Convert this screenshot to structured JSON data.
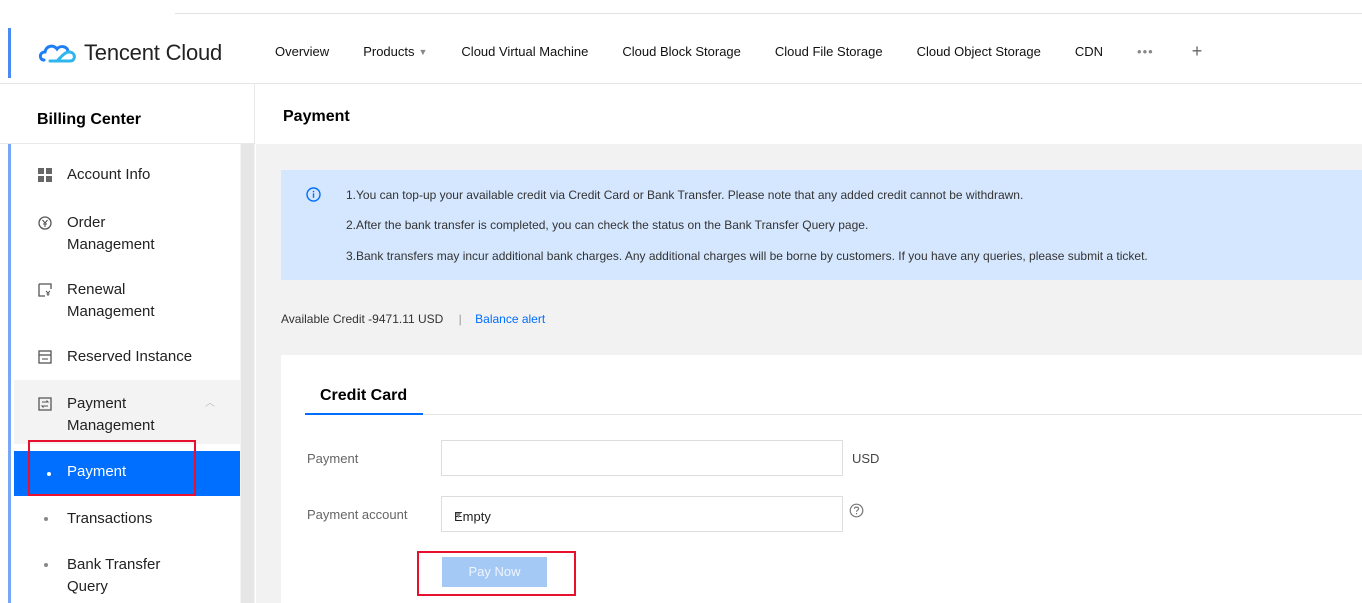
{
  "header": {
    "logo_text": "Tencent Cloud",
    "nav": [
      {
        "label": "Overview"
      },
      {
        "label": "Products"
      },
      {
        "label": "Cloud Virtual Machine"
      },
      {
        "label": "Cloud Block Storage"
      },
      {
        "label": "Cloud File Storage"
      },
      {
        "label": "Cloud Object Storage"
      },
      {
        "label": "CDN"
      }
    ],
    "more": "•••",
    "plus": "+"
  },
  "sidebar": {
    "title": "Billing Center",
    "items": [
      {
        "line1": "Account Info",
        "line2": ""
      },
      {
        "line1": "Order",
        "line2": "Management"
      },
      {
        "line1": "Renewal",
        "line2": "Management"
      },
      {
        "line1": "Reserved Instance",
        "line2": ""
      },
      {
        "line1": "Payment",
        "line2": "Management"
      }
    ],
    "subitems": {
      "payment": "Payment",
      "transactions": "Transactions",
      "bank_line1": "Bank Transfer",
      "bank_line2": "Query"
    }
  },
  "main": {
    "title": "Payment",
    "notice": [
      "1.You can top-up your available credit via Credit Card or Bank Transfer. Please note that any added credit cannot be withdrawn.",
      "2.After the bank transfer is completed, you can check the status on the Bank Transfer Query page.",
      "3.Bank transfers may incur additional bank charges. Any additional charges will be borne by customers. If you have any queries, please submit a ticket."
    ],
    "credit": {
      "label": "Available Credit",
      "value": "-9471.11 USD",
      "separator": "|",
      "link": "Balance alert"
    },
    "tab": "Credit Card",
    "form": {
      "payment_label": "Payment",
      "payment_value": "",
      "unit": "USD",
      "account_label": "Payment account",
      "account_value": "Empty"
    },
    "pay_button": "Pay Now"
  },
  "colors": {
    "accent": "#006eff",
    "notice_bg": "#d5e7fe",
    "highlight": "#e8112d",
    "button_disabled": "#a5c9f5"
  }
}
